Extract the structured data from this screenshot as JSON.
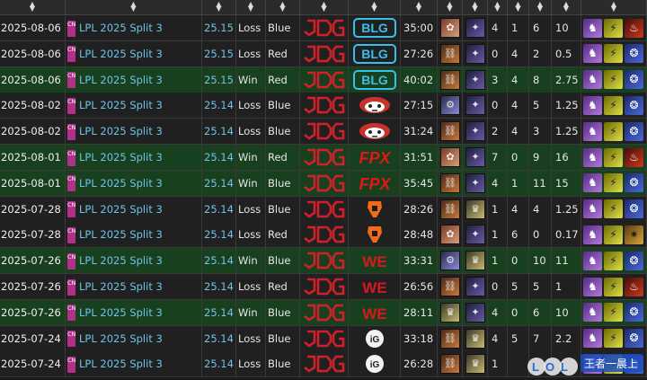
{
  "table": {
    "header_sort_glyph": "▲▼",
    "rows": [
      {
        "date": "2025-08-06",
        "region": "CN",
        "tournament": "LPL 2025 Split 3",
        "patch": "25.15",
        "result": "Loss",
        "side": "Blue",
        "team": "JDG",
        "opponent": "BLG",
        "length": "35:00",
        "champ1": "ahri",
        "champ2": "kaisa",
        "k": "4",
        "d": "1",
        "a": "6",
        "kda": "10",
        "items": [
          "purple",
          "yellow",
          "red"
        ]
      },
      {
        "date": "2025-08-06",
        "region": "CN",
        "tournament": "LPL 2025 Split 3",
        "patch": "25.15",
        "result": "Loss",
        "side": "Red",
        "team": "JDG",
        "opponent": "BLG",
        "length": "27:26",
        "champ1": "sylas",
        "champ2": "kaisa",
        "k": "0",
        "d": "4",
        "a": "2",
        "kda": "0.5",
        "items": [
          "purple",
          "yellow",
          "blue"
        ]
      },
      {
        "date": "2025-08-06",
        "region": "CN",
        "tournament": "LPL 2025 Split 3",
        "patch": "25.15",
        "result": "Win",
        "side": "Red",
        "team": "JDG",
        "opponent": "BLG",
        "length": "40:02",
        "champ1": "sylas",
        "champ2": "kaisa",
        "k": "3",
        "d": "4",
        "a": "8",
        "kda": "2.75",
        "items": [
          "purple",
          "yellow",
          "blue"
        ]
      },
      {
        "date": "2025-08-02",
        "region": "CN",
        "tournament": "LPL 2025 Split 3",
        "patch": "25.14",
        "result": "Loss",
        "side": "Blue",
        "team": "JDG",
        "opponent": "IG-dog",
        "length": "27:15",
        "champ1": "viktor",
        "champ2": "kaisa",
        "k": "0",
        "d": "4",
        "a": "5",
        "kda": "1.25",
        "items": [
          "purple",
          "yellow",
          "blue"
        ]
      },
      {
        "date": "2025-08-02",
        "region": "CN",
        "tournament": "LPL 2025 Split 3",
        "patch": "25.14",
        "result": "Loss",
        "side": "Blue",
        "team": "JDG",
        "opponent": "IG-dog",
        "length": "31:24",
        "champ1": "sylas",
        "champ2": "kaisa",
        "k": "2",
        "d": "4",
        "a": "3",
        "kda": "1.25",
        "items": [
          "purple",
          "yellow",
          "blue"
        ]
      },
      {
        "date": "2025-08-01",
        "region": "CN",
        "tournament": "LPL 2025 Split 3",
        "patch": "25.14",
        "result": "Win",
        "side": "Red",
        "team": "JDG",
        "opponent": "FPX",
        "length": "31:51",
        "champ1": "ahri",
        "champ2": "kaisa",
        "k": "7",
        "d": "0",
        "a": "9",
        "kda": "16",
        "items": [
          "purple",
          "yellow",
          "red"
        ]
      },
      {
        "date": "2025-08-01",
        "region": "CN",
        "tournament": "LPL 2025 Split 3",
        "patch": "25.14",
        "result": "Win",
        "side": "Blue",
        "team": "JDG",
        "opponent": "FPX",
        "length": "35:45",
        "champ1": "sylas",
        "champ2": "kaisa",
        "k": "4",
        "d": "1",
        "a": "11",
        "kda": "15",
        "items": [
          "purple",
          "yellow",
          "blue"
        ]
      },
      {
        "date": "2025-07-28",
        "region": "CN",
        "tournament": "LPL 2025 Split 3",
        "patch": "25.14",
        "result": "Loss",
        "side": "Blue",
        "team": "JDG",
        "opponent": "TES",
        "length": "28:26",
        "champ1": "sylas",
        "champ2": "azir",
        "k": "1",
        "d": "4",
        "a": "4",
        "kda": "1.25",
        "items": [
          "purple",
          "yellow",
          "blue"
        ]
      },
      {
        "date": "2025-07-28",
        "region": "CN",
        "tournament": "LPL 2025 Split 3",
        "patch": "25.14",
        "result": "Loss",
        "side": "Red",
        "team": "JDG",
        "opponent": "TES",
        "length": "28:48",
        "champ1": "ahri",
        "champ2": "kaisa",
        "k": "1",
        "d": "6",
        "a": "0",
        "kda": "0.17",
        "items": [
          "purple",
          "yellow",
          "gold"
        ]
      },
      {
        "date": "2025-07-26",
        "region": "CN",
        "tournament": "LPL 2025 Split 3",
        "patch": "25.14",
        "result": "Win",
        "side": "Blue",
        "team": "JDG",
        "opponent": "WE",
        "length": "33:31",
        "champ1": "viktor",
        "champ2": "azir",
        "k": "1",
        "d": "0",
        "a": "10",
        "kda": "11",
        "items": [
          "purple",
          "yellow",
          "blue"
        ]
      },
      {
        "date": "2025-07-26",
        "region": "CN",
        "tournament": "LPL 2025 Split 3",
        "patch": "25.14",
        "result": "Loss",
        "side": "Red",
        "team": "JDG",
        "opponent": "WE",
        "length": "26:56",
        "champ1": "sylas",
        "champ2": "kaisa",
        "k": "0",
        "d": "5",
        "a": "5",
        "kda": "1",
        "items": [
          "purple",
          "yellow",
          "red"
        ]
      },
      {
        "date": "2025-07-26",
        "region": "CN",
        "tournament": "LPL 2025 Split 3",
        "patch": "25.14",
        "result": "Win",
        "side": "Blue",
        "team": "JDG",
        "opponent": "WE",
        "length": "28:11",
        "champ1": "azir",
        "champ2": "kaisa",
        "k": "4",
        "d": "0",
        "a": "6",
        "kda": "10",
        "items": [
          "purple",
          "yellow",
          "blue"
        ]
      },
      {
        "date": "2025-07-24",
        "region": "CN",
        "tournament": "LPL 2025 Split 3",
        "patch": "25.14",
        "result": "Loss",
        "side": "Blue",
        "team": "JDG",
        "opponent": "IG",
        "length": "33:18",
        "champ1": "sylas",
        "champ2": "azir",
        "k": "4",
        "d": "5",
        "a": "7",
        "kda": "2.2",
        "items": [
          "purple",
          "yellow",
          "blue"
        ]
      },
      {
        "date": "2025-07-24",
        "region": "CN",
        "tournament": "LPL 2025 Split 3",
        "patch": "25.14",
        "result": "Loss",
        "side": "Blue",
        "team": "JDG",
        "opponent": "IG",
        "length": "26:28",
        "champ1": "sylas",
        "champ2": "azir",
        "k": "1",
        "d": "",
        "a": "",
        "kda": "",
        "items": [
          "purple",
          "yellow",
          "blue"
        ]
      }
    ]
  },
  "watermark": {
    "text": "LOL",
    "tag": "王者一晨上"
  },
  "colors": {
    "win_row": "#18401e",
    "loss_row": "#202020",
    "link": "#6fc3e8",
    "jdg_red": "#d0202a"
  }
}
